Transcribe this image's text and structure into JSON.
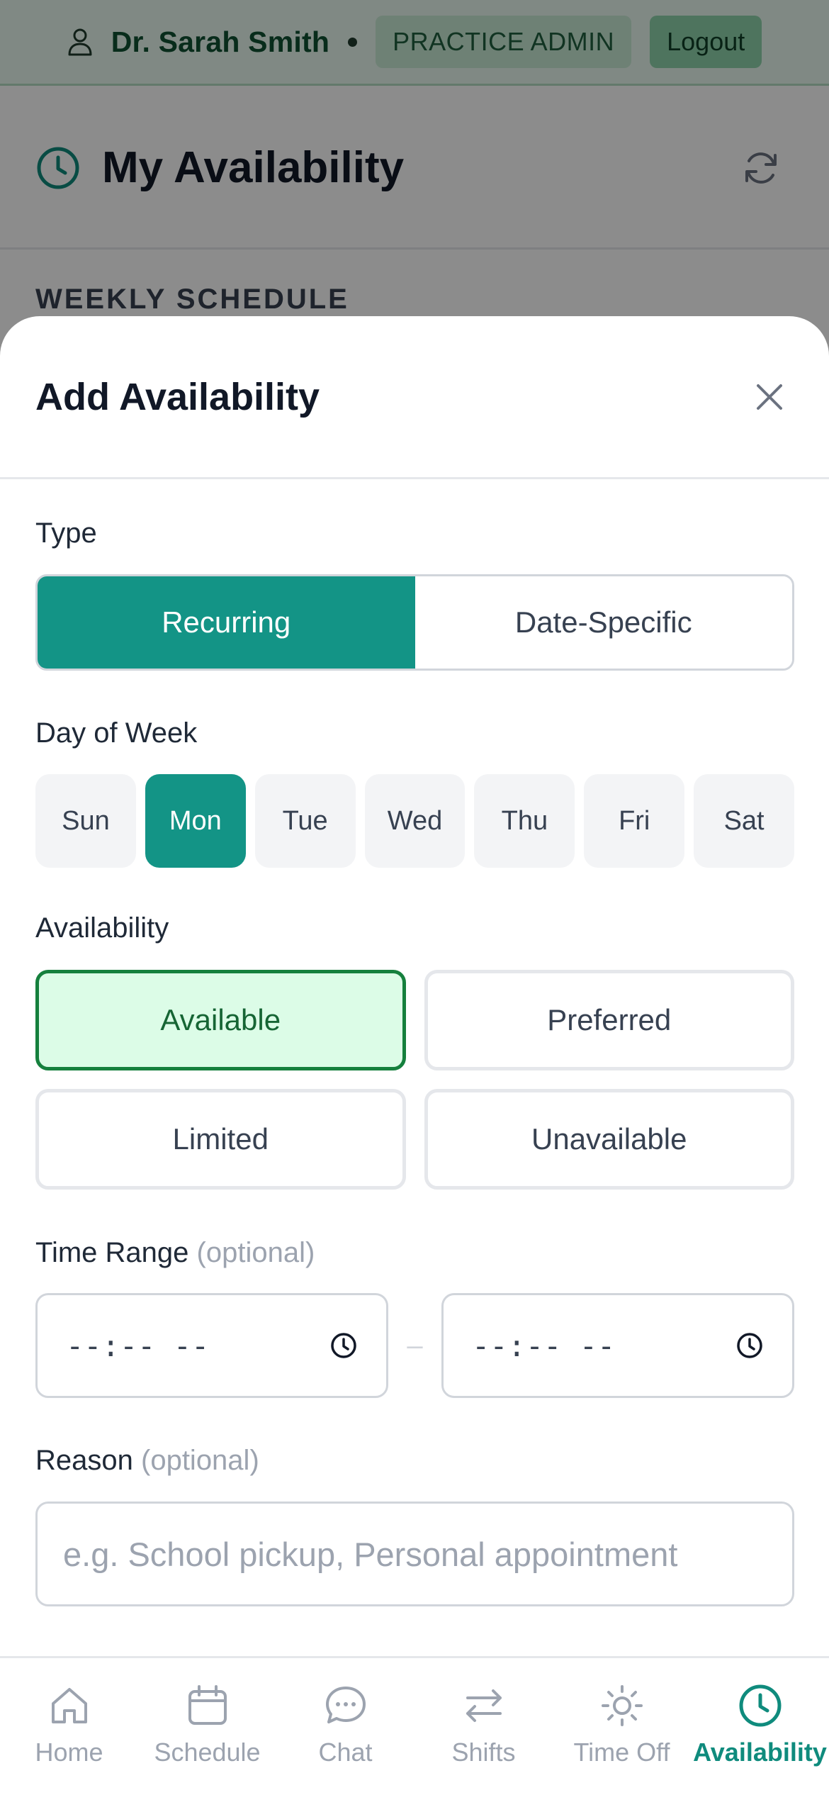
{
  "top_bar": {
    "user_name": "Dr. Sarah Smith",
    "role": "PRACTICE ADMIN",
    "logout_label": "Logout"
  },
  "page": {
    "title": "My Availability",
    "section_label": "WEEKLY SCHEDULE"
  },
  "modal": {
    "title": "Add Availability",
    "type_label": "Type",
    "type_options": [
      "Recurring",
      "Date-Specific"
    ],
    "type_selected": "Recurring",
    "day_label": "Day of Week",
    "days": [
      "Sun",
      "Mon",
      "Tue",
      "Wed",
      "Thu",
      "Fri",
      "Sat"
    ],
    "day_selected": "Mon",
    "availability_label": "Availability",
    "availability_options": [
      "Available",
      "Preferred",
      "Limited",
      "Unavailable"
    ],
    "availability_selected": "Available",
    "time_label": "Time Range",
    "optional_text": "(optional)",
    "time_start_value": "--:-- --",
    "time_end_value": "--:-- --",
    "time_separator": "–",
    "reason_label": "Reason",
    "reason_placeholder": "e.g. School pickup, Personal appointment"
  },
  "nav": {
    "items": [
      {
        "label": "Home",
        "icon": "home-icon"
      },
      {
        "label": "Schedule",
        "icon": "calendar-icon"
      },
      {
        "label": "Chat",
        "icon": "chat-icon"
      },
      {
        "label": "Shifts",
        "icon": "swap-icon"
      },
      {
        "label": "Time Off",
        "icon": "sun-icon"
      },
      {
        "label": "Availability",
        "icon": "clock-icon"
      }
    ],
    "active": "Availability"
  },
  "colors": {
    "accent": "#139486",
    "available_bg": "#dcfce7",
    "available_border": "#15803d",
    "header_bg": "#eafaf0"
  }
}
